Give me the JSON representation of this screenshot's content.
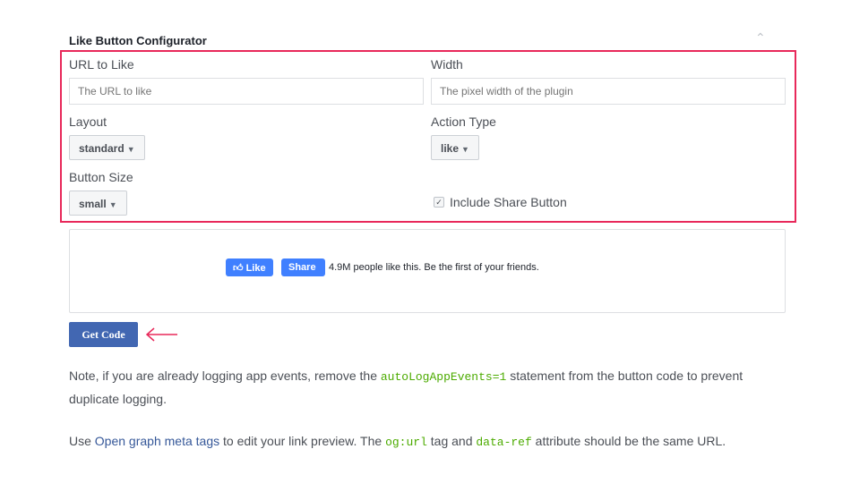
{
  "configurator": {
    "title": "Like Button Configurator",
    "url_label": "URL to Like",
    "url_placeholder": "The URL to like",
    "url_value": "",
    "width_label": "Width",
    "width_placeholder": "The pixel width of the plugin",
    "width_value": "",
    "layout_label": "Layout",
    "layout_value": "standard",
    "action_label": "Action Type",
    "action_value": "like",
    "size_label": "Button Size",
    "size_value": "small",
    "share_label": "Include Share Button",
    "share_checked": true
  },
  "preview": {
    "like_label": "Like",
    "share_label": "Share",
    "social_text": "4.9M people like this. Be the first of your friends."
  },
  "get_code_label": "Get Code",
  "colors": {
    "highlight": "#e8285a",
    "facebook_blue": "#4080ff",
    "button_blue": "#4267b2",
    "code_green": "#4cab00"
  },
  "note": {
    "pre": "Note, if you are already logging app events, remove the ",
    "code": "autoLogAppEvents=1",
    "post": " statement from the button code to prevent duplicate logging."
  },
  "og": {
    "pre": "Use ",
    "link": "Open graph meta tags",
    "mid1": " to edit your link preview. The ",
    "code1": "og:url",
    "mid2": " tag and ",
    "code2": "data-ref",
    "post": " attribute should be the same URL."
  }
}
